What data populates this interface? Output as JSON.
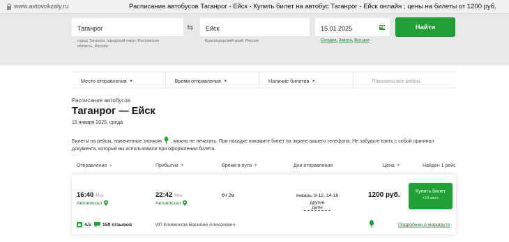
{
  "browser": {
    "url": "www.avtovokzaly.ru",
    "title": "Расписание автобусов Таганрог - Ейск - Купить билет на автобус Таганрог - Ейск онлайн ; цены на билеты от 1200 руб."
  },
  "search": {
    "from": {
      "value": "Таганрог",
      "hint": "город Таганрог городской округ, Ростовская область, Россия"
    },
    "to": {
      "value": "Ейск",
      "hint": "Краснодарский край, Россия"
    },
    "date": {
      "value": "15.01.2025",
      "quick_dates": [
        "Сегодня,",
        "Завтра,",
        "Все дни"
      ]
    },
    "find_button": "Найти"
  },
  "filters": {
    "departure_place": "Место отправления",
    "departure_time": "Время отправления",
    "tickets_available": "Наличие билетов",
    "showing_all": "Показаны все рейсы"
  },
  "page": {
    "kicker": "Расписание автобусов",
    "route_title": "Таганрог — Ейск",
    "date_line": "15 января 2025, среда",
    "notice_part1": "Билеты на рейсы, помеченные значком",
    "notice_part2": ", можно не печатать. При посадке покажите билет на экране вашего телефона. Не забудьте взять с собой оригинал документа, который вы использовали при оформлении билета."
  },
  "table": {
    "headers": {
      "departure": "Отправление",
      "arrival": "Прибытие",
      "travel_time": "Время в пути",
      "days": "Дни отправления",
      "price": "Цена",
      "found": "Найден 1 рейс"
    }
  },
  "trip": {
    "dep_time": "16:40",
    "dep_tz": "Мск",
    "dep_station": "Автовокзал",
    "arr_time": "22:42",
    "arr_tz": "Мск",
    "arr_station": "Автовокзал",
    "duration": "6ч 2м",
    "days": "январь: 8-12, 14-16",
    "other_dates": "другие даты",
    "price": "1200 руб.",
    "buy_label": "Купить билет",
    "seats": "+10 мест",
    "rating": "4.5",
    "reviews": "159 отзывов",
    "carrier": "ИП Клименков Василий Алексеевич",
    "route_link": "Подробнее о маршруте"
  },
  "colors": {
    "accent": "#21a038",
    "link": "#1a7f33",
    "search_bg": "#e9e9e9"
  },
  "icons": [
    "lock-icon",
    "swap-icon",
    "calendar-icon",
    "leaf-icon",
    "map-pin-icon",
    "thumbs-up-icon",
    "chat-icon",
    "sort-icon",
    "caret-down-icon"
  ]
}
